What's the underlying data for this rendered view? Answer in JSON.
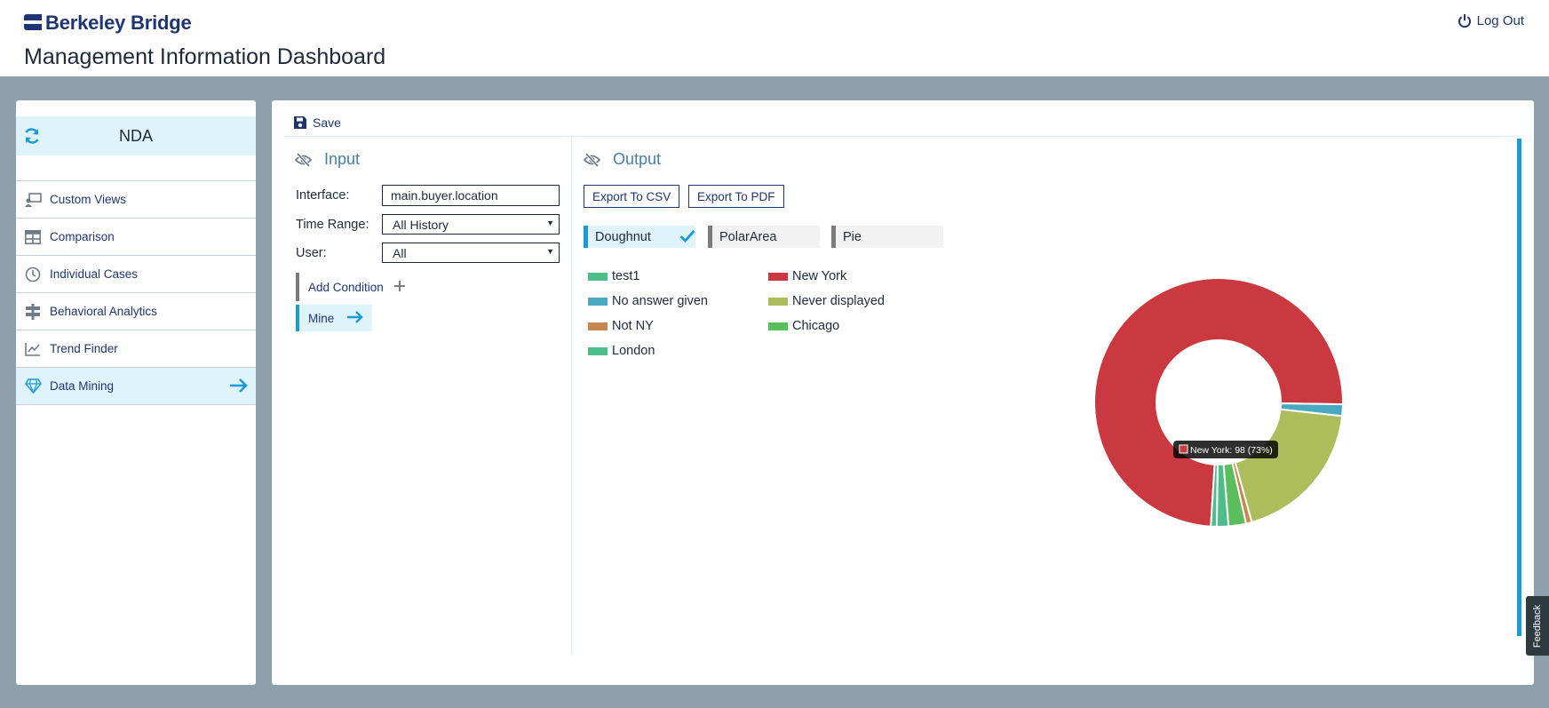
{
  "header": {
    "logo_text": "Berkeley Bridge",
    "page_title": "Management Information Dashboard",
    "logout_label": "Log Out"
  },
  "sidebar": {
    "title": "NDA",
    "items": [
      {
        "label": "Custom Views",
        "icon": "custom-views-icon"
      },
      {
        "label": "Comparison",
        "icon": "table-icon"
      },
      {
        "label": "Individual Cases",
        "icon": "clock-icon"
      },
      {
        "label": "Behavioral Analytics",
        "icon": "signpost-icon"
      },
      {
        "label": "Trend Finder",
        "icon": "trend-line-icon"
      },
      {
        "label": "Data Mining",
        "icon": "diamond-icon",
        "active": true
      }
    ]
  },
  "toolbar": {
    "save_label": "Save"
  },
  "input": {
    "title": "Input",
    "interface_label": "Interface:",
    "interface_value": "main.buyer.location",
    "time_range_label": "Time Range:",
    "time_range_value": "All History",
    "user_label": "User:",
    "user_value": "All",
    "add_condition_label": "Add Condition",
    "mine_label": "Mine"
  },
  "output": {
    "title": "Output",
    "export_csv_label": "Export To CSV",
    "export_pdf_label": "Export To PDF",
    "chart_types": [
      "Doughnut",
      "PolarArea",
      "Pie"
    ],
    "selected_chart_type": "Doughnut",
    "tooltip": "New York: 98 (73%)"
  },
  "chart_data": {
    "type": "pie",
    "variant": "doughnut",
    "legend_placement": "top-left",
    "series": [
      {
        "name": "test1",
        "value": 1,
        "color": "#4dbd8a"
      },
      {
        "name": "New York",
        "value": 98,
        "color": "#c9393f"
      },
      {
        "name": "No answer given",
        "value": 2,
        "color": "#4aa8c0"
      },
      {
        "name": "Never displayed",
        "value": 25,
        "color": "#adbd5c"
      },
      {
        "name": "Not NY",
        "value": 1,
        "color": "#c98750"
      },
      {
        "name": "Chicago",
        "value": 3,
        "color": "#5cbd5c"
      },
      {
        "name": "London",
        "value": 2,
        "color": "#4dbd8a"
      }
    ],
    "draw_order": [
      "New York",
      "No answer given",
      "Never displayed",
      "Not NY",
      "Chicago",
      "London",
      "test1"
    ]
  },
  "feedback_label": "Feedback"
}
